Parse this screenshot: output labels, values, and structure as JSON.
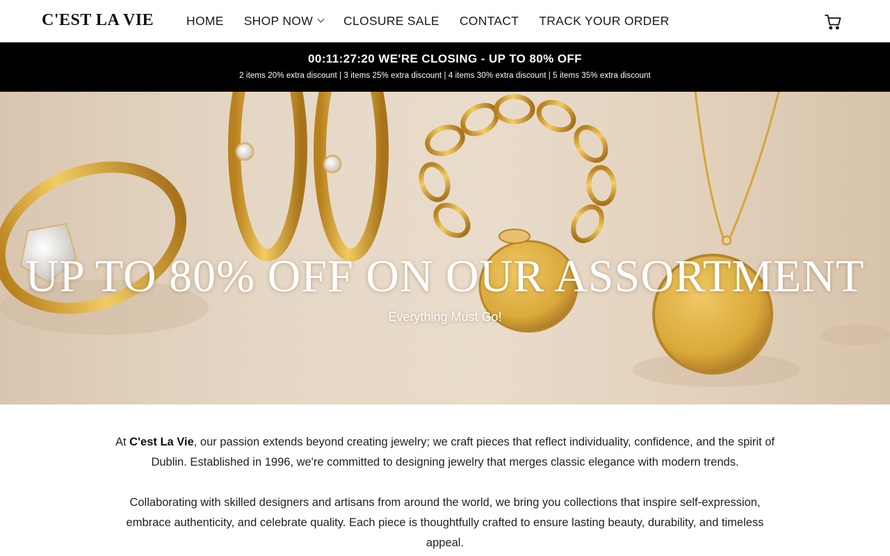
{
  "header": {
    "logo": "C'EST LA VIE",
    "nav": [
      {
        "label": "HOME"
      },
      {
        "label": "SHOP NOW"
      },
      {
        "label": "CLOSURE SALE"
      },
      {
        "label": "CONTACT"
      },
      {
        "label": "TRACK YOUR ORDER"
      }
    ],
    "cart_icon": "cart-icon"
  },
  "announcement": {
    "countdown": "00:11:27:20",
    "headline": "WE'RE CLOSING - UP TO 80% OFF",
    "discounts": "2 items 20% extra discount | 3 items 25% extra discount | 4 items 30% extra discount | 5 items 35% extra discount"
  },
  "hero": {
    "title": "UP TO 80% OFF ON OUR ASSORTMENT",
    "subtitle": "Everything Must Go!"
  },
  "about": {
    "p1_prefix": "At ",
    "p1_brand": "C'est La Vie",
    "p1_rest": ", our passion extends beyond creating jewelry; we craft pieces that reflect individuality, confidence, and the spirit of Dublin. Established in 1996, we're committed to designing jewelry that merges classic elegance with modern trends.",
    "p2": "Collaborating with skilled designers and artisans from around the world, we bring you collections that inspire self-expression, embrace authenticity, and celebrate quality. Each piece is thoughtfully crafted to ensure lasting beauty, durability, and timeless appeal."
  },
  "colors": {
    "announcement_bg": "#000000",
    "gold": "#d9a93a",
    "hero_bg": "#e6d8c6"
  }
}
